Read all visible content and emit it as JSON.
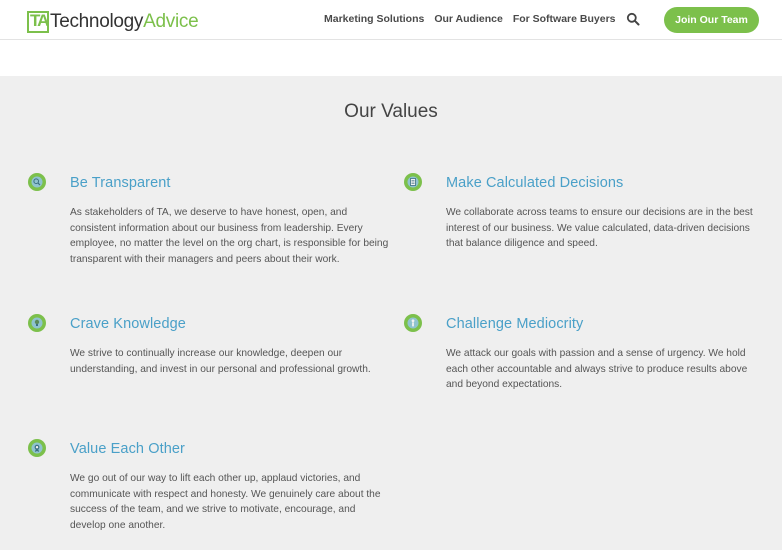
{
  "brand": {
    "mark": "TA",
    "name_part1": "Technology",
    "name_part2": "Advice"
  },
  "nav": {
    "items": [
      {
        "label": "Marketing Solutions"
      },
      {
        "label": "Our Audience"
      },
      {
        "label": "For Software Buyers"
      }
    ],
    "cta_label": "Join Our Team"
  },
  "section": {
    "title": "Our Values"
  },
  "values": [
    {
      "icon": "magnifier-icon",
      "title": "Be Transparent",
      "body": "As stakeholders of TA, we deserve to have honest, open, and consistent information about our business from leadership. Every employee, no matter the level on the org chart, is responsible for being transparent with their managers and peers about their work."
    },
    {
      "icon": "clipboard-icon",
      "title": "Make Calculated Decisions",
      "body": "We collaborate across teams to ensure our decisions are in the best interest of our business. We value calculated, data-driven decisions that balance diligence and speed."
    },
    {
      "icon": "lightbulb-icon",
      "title": "Crave Knowledge",
      "body": "We strive to continually increase our knowledge, deepen our understanding, and invest in our personal and professional growth."
    },
    {
      "icon": "person-icon",
      "title": "Challenge Mediocrity",
      "body": "We attack our goals with passion and a sense of urgency. We hold each other accountable and always strive to produce results above and beyond expectations."
    },
    {
      "icon": "award-icon",
      "title": "Value Each Other",
      "body": "We go out of our way to lift each other up, applaud victories, and communicate with respect and honesty. We genuinely care about the success of the team, and we strive to motivate, encourage, and develop one another."
    }
  ],
  "colors": {
    "brand_green": "#7cc04b",
    "heading_blue": "#4aa0c8",
    "section_bg": "#efefef"
  }
}
